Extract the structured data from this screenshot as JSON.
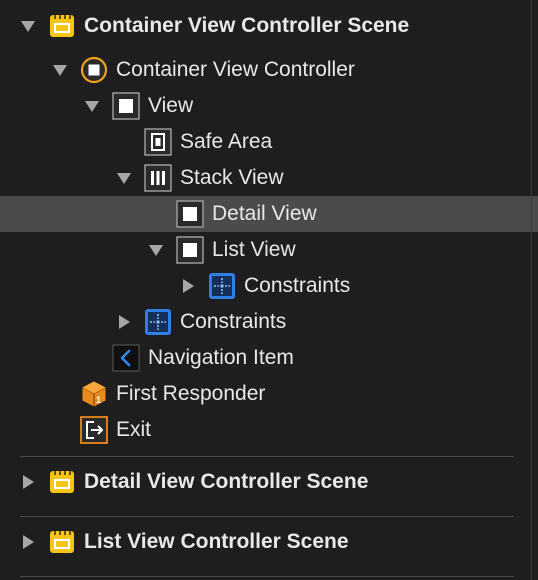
{
  "outline": {
    "scene_container": "Container View Controller Scene",
    "container_vc": "Container View Controller",
    "view": "View",
    "safe_area": "Safe Area",
    "stack_view": "Stack View",
    "detail_view": "Detail View",
    "list_view": "List View",
    "list_view_constraints": "Constraints",
    "view_constraints": "Constraints",
    "navigation_item": "Navigation Item",
    "first_responder": "First Responder",
    "exit": "Exit",
    "scene_detail": "Detail View Controller Scene",
    "scene_list": "List View Controller Scene"
  },
  "colors": {
    "background": "#1e1e1e",
    "selection": "#4b4b4d",
    "scene_yellow": "#f5c518",
    "vc_orange": "#f0a11e",
    "constraint_blue": "#2f7fe6",
    "exit_orange": "#e8891d"
  }
}
